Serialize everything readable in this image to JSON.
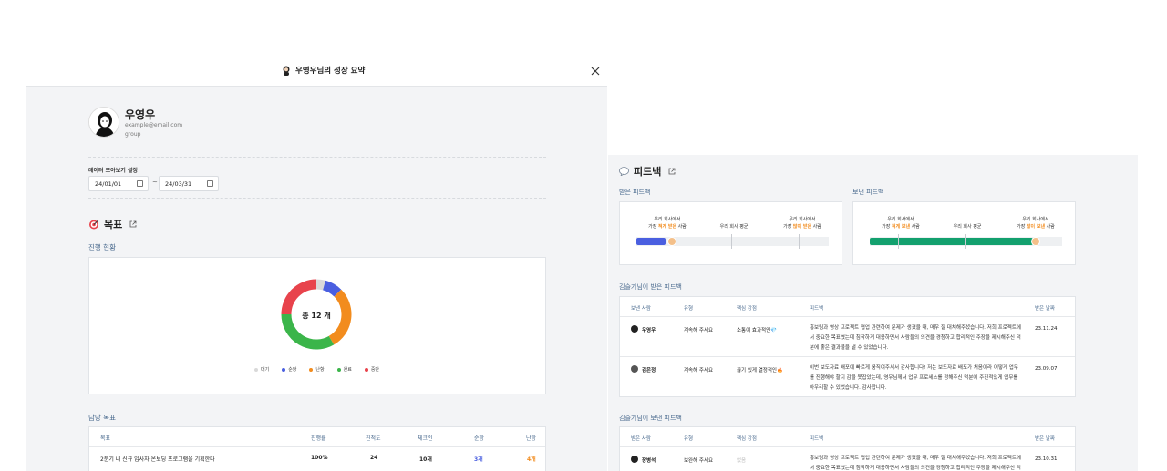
{
  "modal": {
    "title": "우영우님의 성장 요약",
    "profile": {
      "name": "우영우",
      "email": "example@email.com",
      "group": "group"
    },
    "range_label": "데이터 모아보기 설정",
    "start_date": "24/01/01",
    "end_date": "24/03/31",
    "range_sep": "~",
    "goal": {
      "title": "목표",
      "progress_label": "진행 현황",
      "total_text": "총 12 개",
      "legend": [
        "대기",
        "순항",
        "난항",
        "완료",
        "중단"
      ],
      "assigned_label": "담당 목표",
      "table_headers": [
        "목표",
        "진행률",
        "진척도",
        "체크인",
        "순항",
        "난항"
      ],
      "rows": [
        {
          "goal": "2분기 내 신규 입사자 온보딩 프로그램을 기획한다",
          "rate": "100%",
          "progress": "24",
          "checkin": "10개",
          "smooth": "3개",
          "rough": "4개"
        }
      ]
    }
  },
  "chart_data": {
    "type": "pie",
    "categories": [
      "대기",
      "순항",
      "난항",
      "완료",
      "중단"
    ],
    "values": [
      0.5,
      1,
      3.5,
      4,
      3
    ],
    "colors": [
      "#d9d9d9",
      "#4a5fe0",
      "#f28c1e",
      "#3bb54a",
      "#e8434c"
    ],
    "center_text": "총 12 개"
  },
  "colors": {
    "received_bar": "#4a5fe0",
    "sent_bar": "#13a06e",
    "link_blue": "#4a6a8e"
  },
  "feedback": {
    "title": "피드백",
    "received_label": "받은 피드백",
    "sent_label": "보낸 피드백",
    "received_card": {
      "left_l1": "우리 회사에서",
      "left_l2_pre": "가장 ",
      "left_l2_hl": "적게 받은",
      "left_l2_post": " 사람",
      "mid": "우리 회사 평균",
      "right_l1": "우리 회사에서",
      "right_l2_pre": "가장 ",
      "right_l2_hl": "많이 받은",
      "right_l2_post": " 사람",
      "fill_ratio": 0.15
    },
    "sent_card": {
      "left_l1": "우리 회사에서",
      "left_l2_pre": "가장 ",
      "left_l2_hl": "적게 보낸",
      "left_l2_post": " 사람",
      "mid": "우리 회사 평균",
      "right_l1": "우리 회사에서",
      "right_l2_pre": "가장 ",
      "right_l2_hl": "많이 보낸",
      "right_l2_post": " 사람",
      "fill_ratio": 0.85
    },
    "received_table_label": "김슬기님이 받은 피드백",
    "sent_table_label": "김슬기님이 보낸 피드백",
    "table_headers_received": [
      "보낸 사람",
      "유형",
      "핵심 강점",
      "피드백",
      "받은 날짜"
    ],
    "table_headers_sent": [
      "받은 사람",
      "유형",
      "핵심 강점",
      "피드백",
      "받은 날짜"
    ],
    "received_rows": [
      {
        "person": "우영우",
        "type": "계속해 주세요",
        "strength": "소통이 효과적인💎",
        "text1": "홍보팀과 영상 프로젝트 협업 관련하여 문제가 생겼을 때, 매우 잘 대처해주셨습니다. 저희 프로젝트에",
        "text2": "서 중요한 목표였는데 침착하게 대응하면서 사람들의 의견을 경청하고 합리적인 주장을 제시해주신 덕",
        "text3": "분에 좋은 결과물을 낼 수 있었습니다.",
        "date": "23.11.24"
      },
      {
        "person": "김은정",
        "type": "계속해 주세요",
        "strength": "끊기 있게 열정적인🔥",
        "text1": "이번 보도자료 배포에 빠르게 움직여주셔서 감사합니다! 저는 보도자료 배포가 처음이라 어떻게 업무",
        "text2": "를 진행해야 할지 감을 못잡았는데, 영우님께서 업무 프로세스를 정해주신 덕분에 주진적있게 업무를",
        "text3": "아우리할 수 있었습니다. 감사합니다.",
        "date": "23.09.07"
      }
    ],
    "sent_rows": [
      {
        "person": "장병석",
        "type": "보완해 주세요",
        "strength": "없음",
        "text1": "홍보팀과 영상 프로젝트 협업 관련하여 문제가 생겼을 때, 매우 잘 대처해주셨습니다. 저희 프로젝트에",
        "text2": "서 중요한 목표였는데 침착하게 대응하면서 사람들의 의견을 경청하고 합리적인 주장을 제시해주신 덕",
        "date": "23.10.31"
      }
    ]
  }
}
